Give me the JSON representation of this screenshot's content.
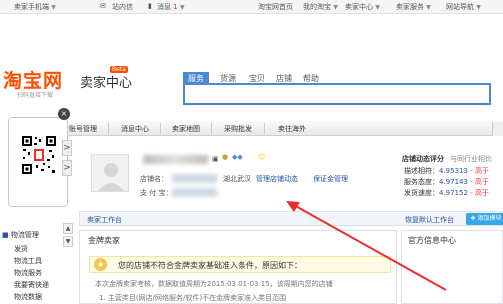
{
  "topbar": {
    "mobile": "卖家手机端",
    "messages_icon": "envelope-icon",
    "station": "站内信",
    "notice": "消息",
    "notice_count": "1",
    "taobao_home": "淘宝网首页",
    "my_taobao": "我的淘宝",
    "seller_center": "卖家中心",
    "seller_service": "卖家服务",
    "site_nav": "网站导航"
  },
  "header": {
    "logo": "淘宝网",
    "logo_sub": "卖家中心",
    "beta": "Beta",
    "slogan": "扫码直接下载"
  },
  "search": {
    "tabs": [
      "服务",
      "货源",
      "宝贝",
      "店铺",
      "帮助"
    ],
    "active_tab": "服务",
    "value": ""
  },
  "nav": {
    "items": [
      "账号管理",
      "消息中心",
      "卖家地图",
      "采购批发",
      "卖往海外"
    ]
  },
  "qr": {
    "close": "×",
    "next": ">",
    "prev": ">"
  },
  "sidebar": {
    "heading": "物流管理",
    "items": [
      "发货",
      "物流工具",
      "物流服务",
      "我要寄快递",
      "物流数据"
    ],
    "up": "▲",
    "down": "▼"
  },
  "profile": {
    "location_label": "店铺名：",
    "location": "湖北武汉",
    "manage_link": "管理店铺动态",
    "deposit_link": "保证金管理",
    "alipay_label": "支 付 宝："
  },
  "dsr": {
    "title": "店铺动态评分",
    "compare": "与同行业相比",
    "rows": [
      {
        "label": "描述相符：",
        "value": "4.95313",
        "compare": "- 高于"
      },
      {
        "label": "服务态度：",
        "value": "4.97143",
        "compare": "- 高于"
      },
      {
        "label": "发货速度：",
        "value": "4.97152",
        "compare": "- 高于"
      }
    ]
  },
  "workbench": {
    "title": "卖家工作台",
    "set_default": "恢复默认工作台",
    "add_button": "添加模块"
  },
  "gold": {
    "title": "金牌卖家",
    "notice": "您的店铺不符合金牌卖家基础准入条件，原因如下：",
    "line1": "本次金牌卖家考核，数据取值周期为2015.03.01-03.15，该周期内您的店铺",
    "line2": "1. 主营类目(网店/网络服务/软件)不在金牌卖家准入类目范围"
  },
  "news": {
    "title": "官方信息中心"
  },
  "colors": {
    "brand": "#ff5000",
    "link": "#2855a6",
    "search": "#4c88d6",
    "arrow": "#e8302f"
  }
}
